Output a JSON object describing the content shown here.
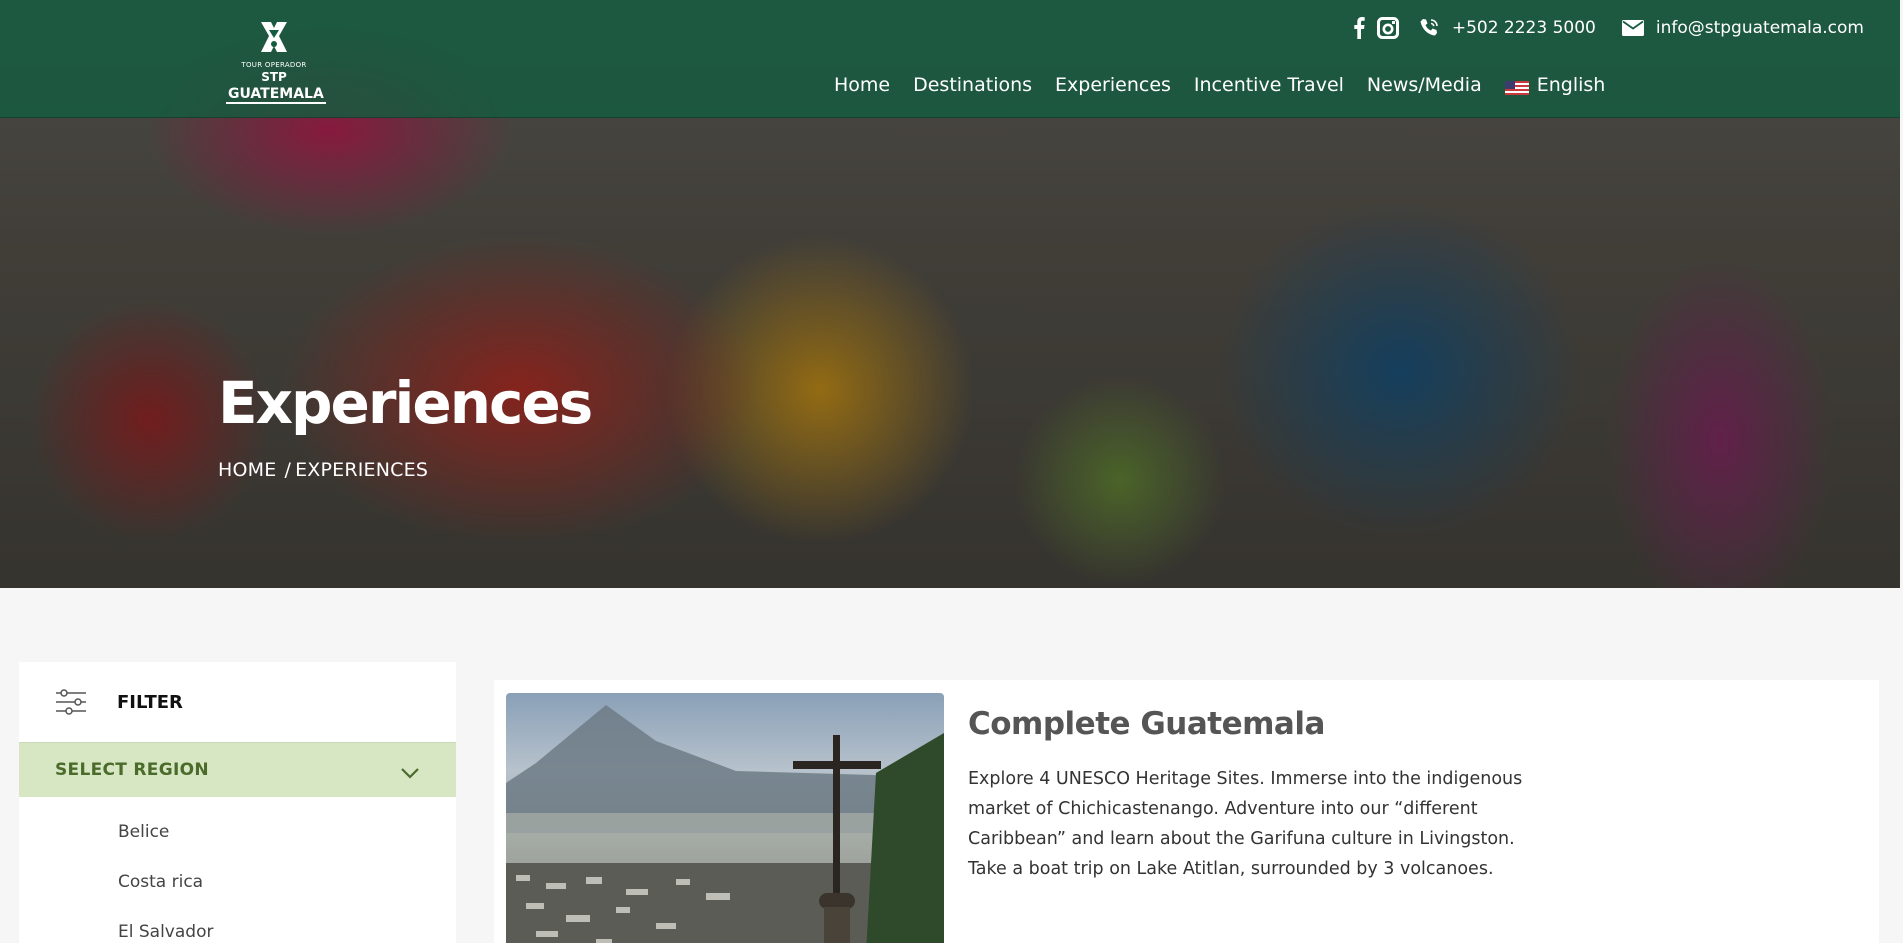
{
  "header": {
    "logo": {
      "subtitle": "TOUR OPERADOR",
      "name_line1": "STP",
      "name_line2": "GUATEMALA"
    },
    "contact": {
      "phone": "+502 2223 5000",
      "email": "info@stpguatemala.com"
    },
    "social": [
      "facebook-icon",
      "instagram-icon"
    ],
    "nav": [
      {
        "label": "Home"
      },
      {
        "label": "Destinations"
      },
      {
        "label": "Experiences"
      },
      {
        "label": "Incentive Travel"
      },
      {
        "label": "News/Media"
      }
    ],
    "language": {
      "label": "English",
      "flag": "us-flag-icon"
    }
  },
  "hero": {
    "title": "Experiences",
    "breadcrumb": {
      "home": "HOME",
      "separator": "/",
      "current": "EXPERIENCES"
    }
  },
  "filter": {
    "label": "FILTER",
    "region_select": "SELECT REGION",
    "regions": [
      "Belice",
      "Costa rica",
      "El Salvador"
    ]
  },
  "experience": {
    "title": "Complete Guatemala",
    "description_lines": [
      "Explore 4 UNESCO Heritage Sites. Immerse into the indigenous",
      "market of Chichicastenango.  Adventure into our “different",
      "Caribbean” and learn about the Garifuna culture in Livingston.",
      " Take a boat trip on Lake Atitlan, surrounded by 3 volcanoes."
    ]
  },
  "colors": {
    "header_green": "#145c40",
    "region_bar": "#d7e6c3",
    "region_text": "#4b6b2b"
  }
}
